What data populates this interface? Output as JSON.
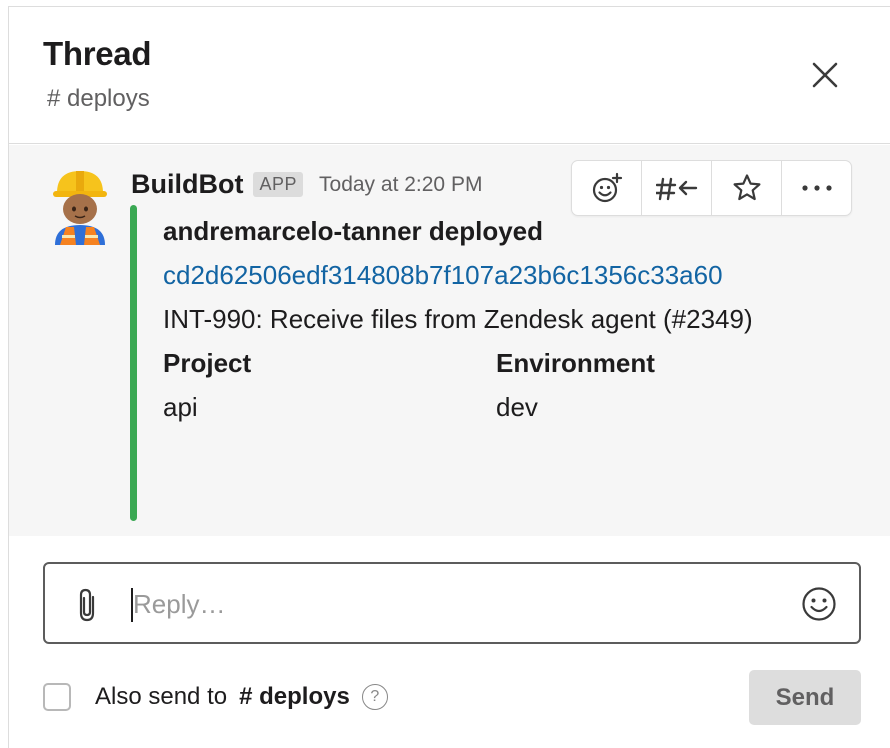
{
  "header": {
    "title": "Thread",
    "channel": "# deploys"
  },
  "message": {
    "sender": "BuildBot",
    "badge": "APP",
    "timestamp": "Today at 2:20 PM",
    "avatar_icon": "construction-worker-emoji",
    "toolbar": {
      "icons": [
        "add-reaction-icon",
        "share-to-channel-icon",
        "star-icon",
        "more-actions-icon"
      ]
    },
    "attachment": {
      "accent_color": "#3aa853",
      "deploy_line": "andremarcelo-tanner deployed",
      "commit_link": "cd2d62506edf314808b7f107a23b6c1356c33a60",
      "commit_title": "INT-990: Receive files from Zendesk agent (#2349)",
      "fields": [
        {
          "label": "Project",
          "value": "api"
        },
        {
          "label": "Environment",
          "value": "dev"
        }
      ]
    }
  },
  "composer": {
    "placeholder": "Reply…",
    "value": ""
  },
  "footer": {
    "also_send_label": "Also send to",
    "channel": "# deploys",
    "send_label": "Send",
    "checked": false
  }
}
